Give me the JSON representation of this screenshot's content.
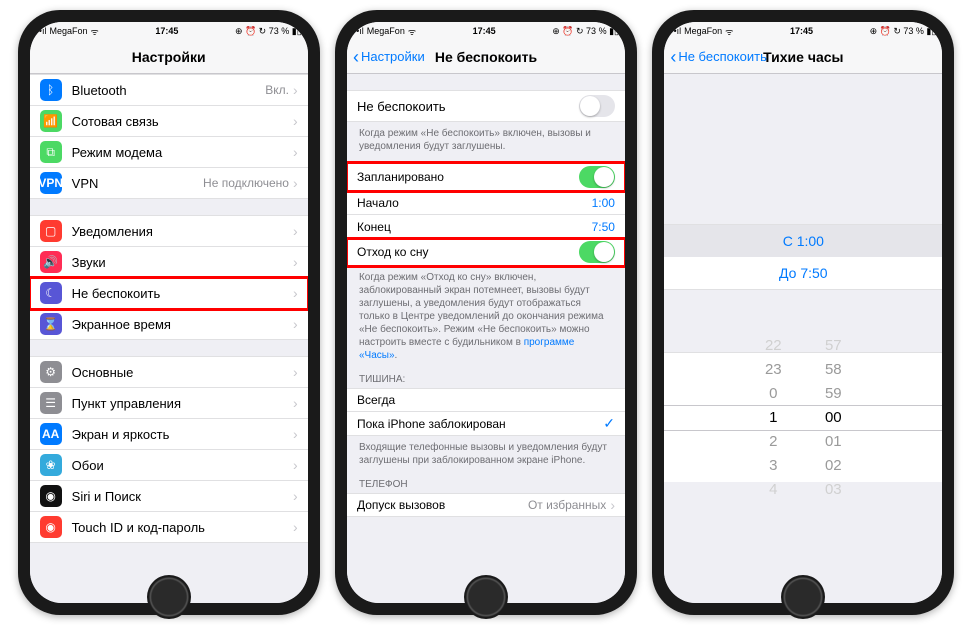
{
  "status": {
    "signal": "••ıl",
    "carrier": "MegaFon",
    "wifi": "ᯤ",
    "time": "17:45",
    "indicators": "⊕ ⏰ ↻ 73 % ▮▯"
  },
  "phone1": {
    "title": "Настройки",
    "g1": [
      {
        "icon": "bt",
        "glyph": "ᛒ",
        "label": "Bluetooth",
        "detail": "Вкл.",
        "chev": true
      },
      {
        "icon": "cell",
        "glyph": "📶",
        "label": "Сотовая связь",
        "detail": "",
        "chev": true
      },
      {
        "icon": "hot",
        "glyph": "⧉",
        "label": "Режим модема",
        "detail": "",
        "chev": true
      },
      {
        "icon": "vpn",
        "glyph": "VPN",
        "label": "VPN",
        "detail": "Не подключено",
        "chev": true
      }
    ],
    "g2": [
      {
        "icon": "notif",
        "glyph": "▢",
        "label": "Уведомления",
        "chev": true
      },
      {
        "icon": "sound",
        "glyph": "🔊",
        "label": "Звуки",
        "chev": true
      },
      {
        "icon": "dnd",
        "glyph": "☾",
        "label": "Не беспокоить",
        "chev": true,
        "hl": true
      },
      {
        "icon": "screen",
        "glyph": "⌛",
        "label": "Экранное время",
        "chev": true
      }
    ],
    "g3": [
      {
        "icon": "gen",
        "glyph": "⚙",
        "label": "Основные",
        "chev": true
      },
      {
        "icon": "ctrl",
        "glyph": "☰",
        "label": "Пункт управления",
        "chev": true
      },
      {
        "icon": "disp",
        "glyph": "AA",
        "label": "Экран и яркость",
        "chev": true
      },
      {
        "icon": "wall",
        "glyph": "❀",
        "label": "Обои",
        "chev": true
      },
      {
        "icon": "siri",
        "glyph": "◉",
        "label": "Siri и Поиск",
        "chev": true
      },
      {
        "icon": "touch",
        "glyph": "◉",
        "label": "Touch ID и код-пароль",
        "chev": true
      }
    ]
  },
  "phone2": {
    "back": "Настройки",
    "title": "Не беспокоить",
    "dnd_label": "Не беспокоить",
    "dnd_footer": "Когда режим «Не беспокоить» включен, вызовы и уведомления будут заглушены.",
    "sched_label": "Запланировано",
    "start_label": "Начало",
    "start_val": "1:00",
    "end_label": "Конец",
    "end_val": "7:50",
    "bedtime_label": "Отход ко сну",
    "bedtime_footer": "Когда режим «Отход ко сну» включен, заблокированный экран потемнеет, вызовы будут заглушены, а уведомления будут отображаться только в Центре уведомлений до окончания режима «Не беспокоить». Режим «Не беспокоить» можно настроить вместе с будильником в ",
    "bedtime_link": "программе «Часы»",
    "silence_header": "ТИШИНА:",
    "always": "Всегда",
    "locked": "Пока iPhone заблокирован",
    "silence_footer": "Входящие телефонные вызовы и уведомления будут заглушены при заблокированном экране iPhone.",
    "phone_header": "ТЕЛЕФОН",
    "allow_calls": "Допуск вызовов",
    "allow_calls_val": "От избранных"
  },
  "phone3": {
    "back": "Не беспокоить",
    "title": "Тихие часы",
    "from_label": "С 1:00",
    "to_label": "До 7:50",
    "picker": {
      "hours": [
        "22",
        "23",
        "0",
        "1",
        "2",
        "3",
        "4"
      ],
      "mins": [
        "57",
        "58",
        "59",
        "00",
        "01",
        "02",
        "03"
      ],
      "sel_h": "1",
      "sel_m": "00"
    }
  }
}
